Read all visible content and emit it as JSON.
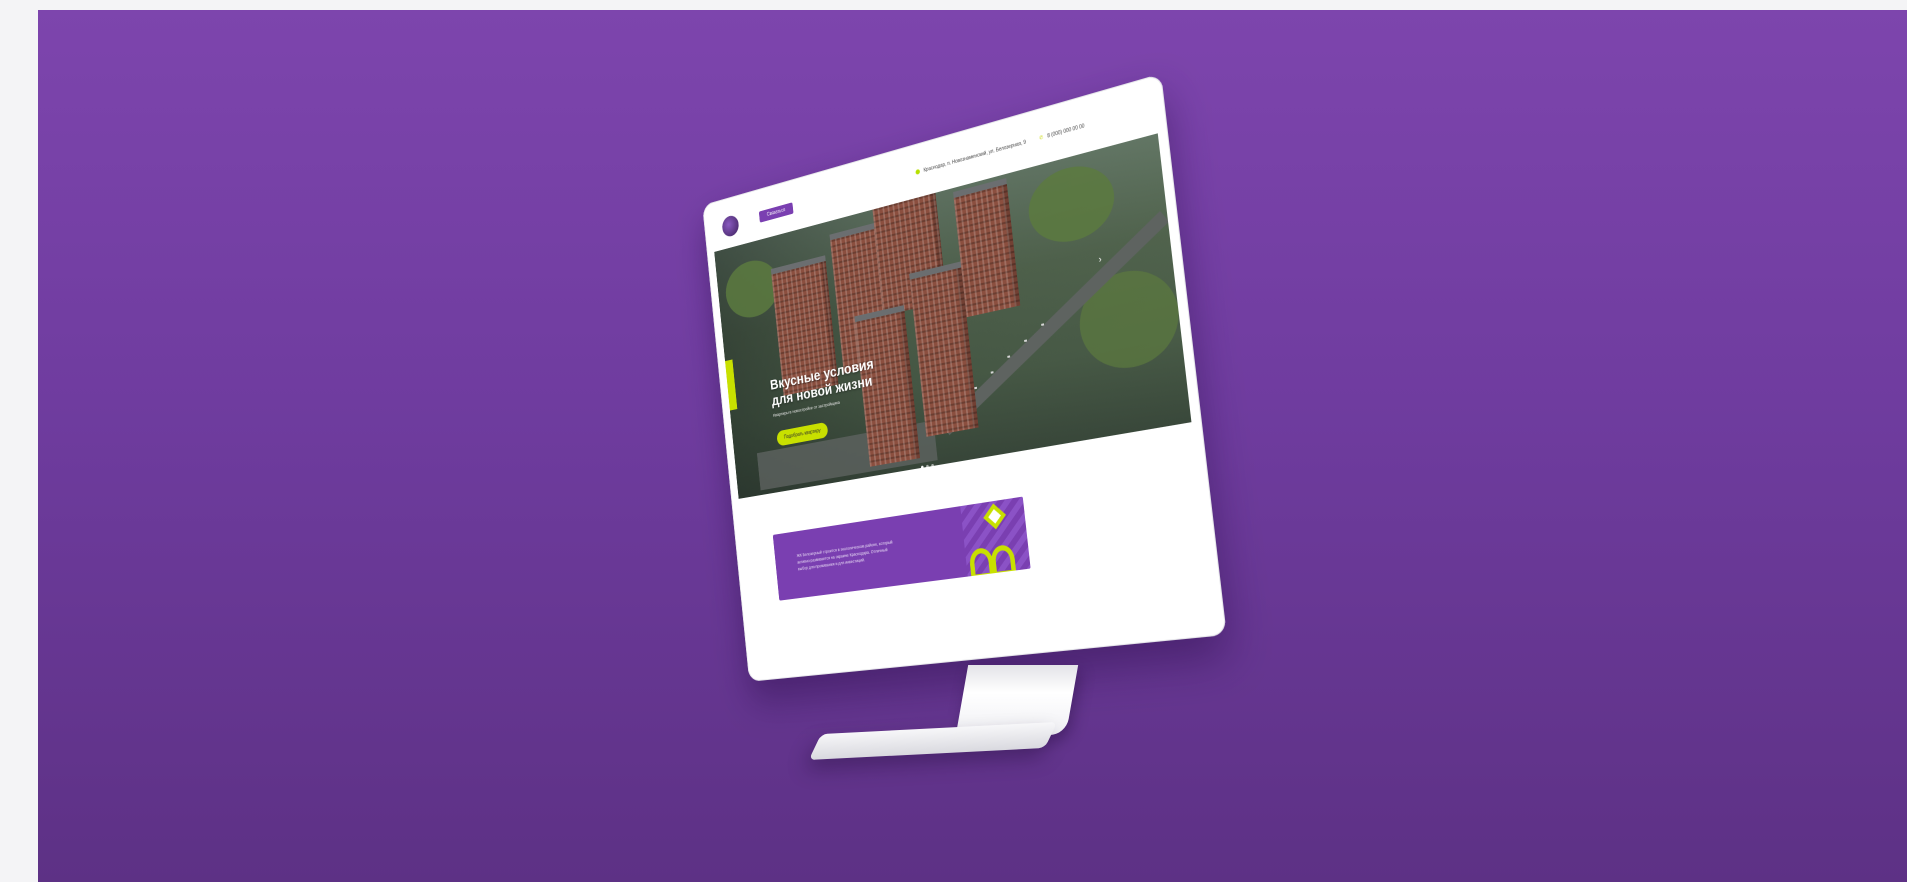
{
  "colors": {
    "background_purple": "#7d45ad",
    "accent_lime": "#c8e000",
    "brand_purple": "#7a3fb1"
  },
  "site": {
    "header": {
      "logo": "",
      "button_label": "Связаться",
      "address": "Краснодар, п. Новознаменский, ул. Белозерная, 9",
      "phone": "8 (000) 000 00 00"
    },
    "hero": {
      "title_line1": "Вкусные условия",
      "title_line2": "для новой жизни",
      "subtitle": "Квартиры в новостройке от застройщика",
      "cta_label": "Подобрать квартиру",
      "side_tab_label": ""
    },
    "promo": {
      "text": "ЖК Белозерный строится в экологическом районе, который активно развивается на окраине Краснодара. Отличный выбор для проживания и для инвестиций."
    }
  }
}
